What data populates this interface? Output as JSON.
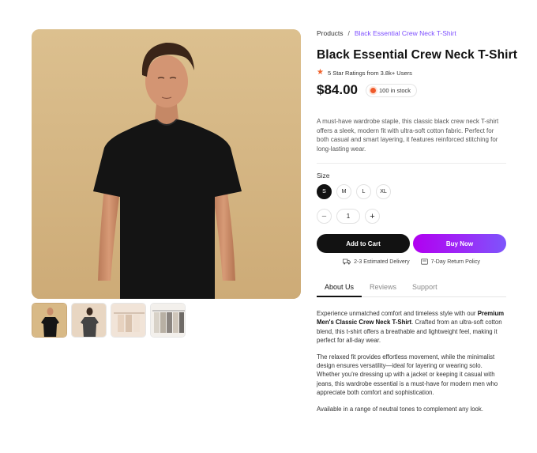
{
  "gallery": {
    "thumbnails": [
      "thumb-model-front",
      "thumb-model-back",
      "thumb-rack",
      "thumb-folded"
    ]
  },
  "breadcrumb": {
    "parent": "Products",
    "separator": "/",
    "current": "Black Essential Crew Neck T-Shirt"
  },
  "product": {
    "title": "Black Essential Crew Neck T-Shirt",
    "rating_text": "5 Star Ratings from 3.8k+ Users",
    "price": "$84.00",
    "stock": "100 in stock",
    "description": "A must-have wardrobe staple, this classic black crew neck T-shirt offers a sleek, modern fit with ultra-soft cotton fabric. Perfect for both casual and smart layering, it features reinforced stitching for long-lasting wear."
  },
  "size": {
    "label": "Size",
    "options": [
      "S",
      "M",
      "L",
      "XL"
    ],
    "selected": "S"
  },
  "quantity": {
    "minus": "−",
    "value": "1",
    "plus": "+"
  },
  "actions": {
    "add_to_cart": "Add to Cart",
    "buy_now": "Buy Now"
  },
  "info": {
    "delivery": "2-3 Estimated Delivery",
    "returns": "7-Day Return Policy"
  },
  "tabs": [
    "About Us",
    "Reviews",
    "Support"
  ],
  "about": {
    "p1_before": "Experience unmatched comfort and timeless style with our ",
    "p1_bold": "Premium Men's Classic Crew Neck T-Shirt",
    "p1_after": ". Crafted from an ultra-soft cotton blend, this t-shirt offers a breathable and lightweight feel, making it perfect for all-day wear.",
    "p2": "The relaxed fit provides effortless movement, while the minimalist design ensures versatility—ideal for layering or wearing solo. Whether you're dressing up with a jacket or keeping it casual with jeans, this wardrobe essential is a must-have for modern men who appreciate both comfort and sophistication.",
    "p3": "Available in a range of neutral tones to complement any look."
  },
  "colors": {
    "accent_purple": "#7c4dff",
    "buy_gradient_start": "#b100f0",
    "buy_gradient_end": "#7d55fb",
    "star": "#f0622c",
    "stock_dot": "#ef5a2b"
  }
}
